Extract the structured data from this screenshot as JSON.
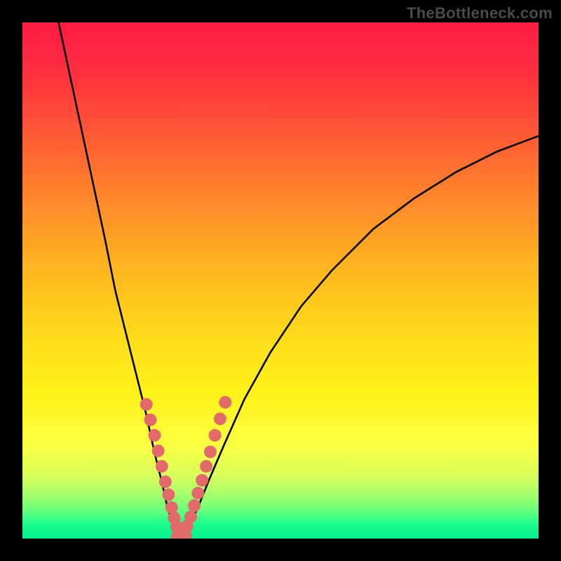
{
  "watermark": "TheBottleneck.com",
  "colors": {
    "frame": "#000000",
    "dot": "#e26a6a",
    "curve": "#000000",
    "gradient_stops": [
      "#ff1a44",
      "#ff5a34",
      "#ffb71f",
      "#fff21a",
      "#9cff6e",
      "#00f090"
    ]
  },
  "chart_data": {
    "type": "line",
    "title": "",
    "xlabel": "",
    "ylabel": "",
    "xlim": [
      0,
      100
    ],
    "ylim": [
      0,
      100
    ],
    "grid": false,
    "legend": false,
    "annotations": [
      "TheBottleneck.com"
    ],
    "series": [
      {
        "name": "curve-left",
        "x": [
          7,
          10,
          13,
          16,
          18,
          20,
          22,
          24,
          25.5,
          27,
          28,
          29,
          29.8,
          30.5
        ],
        "y": [
          100,
          86,
          72,
          58,
          48,
          40,
          32,
          24,
          17,
          11,
          6.5,
          3,
          1,
          0
        ]
      },
      {
        "name": "curve-right",
        "x": [
          30.5,
          32,
          34,
          36,
          39,
          43,
          48,
          54,
          60,
          68,
          76,
          84,
          92,
          100
        ],
        "y": [
          0,
          2,
          6,
          11,
          18,
          27,
          36,
          45,
          52,
          60,
          66,
          71,
          75,
          78
        ]
      }
    ],
    "points": [
      {
        "name": "left-band-dots",
        "coords": [
          [
            24.0,
            26
          ],
          [
            24.8,
            23
          ],
          [
            25.6,
            20
          ],
          [
            26.3,
            17
          ],
          [
            27.0,
            14
          ],
          [
            27.7,
            11
          ],
          [
            28.3,
            8.5
          ],
          [
            28.9,
            6
          ],
          [
            29.4,
            4
          ],
          [
            29.9,
            2.3
          ],
          [
            30.3,
            1
          ]
        ]
      },
      {
        "name": "right-band-dots",
        "coords": [
          [
            31.3,
            1.2
          ],
          [
            31.9,
            2.4
          ],
          [
            32.6,
            4.2
          ],
          [
            33.3,
            6.4
          ],
          [
            34.0,
            8.8
          ],
          [
            34.8,
            11.3
          ],
          [
            35.6,
            14.0
          ],
          [
            36.4,
            16.8
          ],
          [
            37.3,
            20.0
          ],
          [
            38.3,
            23.2
          ],
          [
            39.3,
            26.4
          ]
        ]
      },
      {
        "name": "bottom-dots",
        "coords": [
          [
            30.0,
            0.4
          ],
          [
            30.8,
            0.2
          ],
          [
            31.6,
            0.5
          ]
        ]
      }
    ]
  }
}
